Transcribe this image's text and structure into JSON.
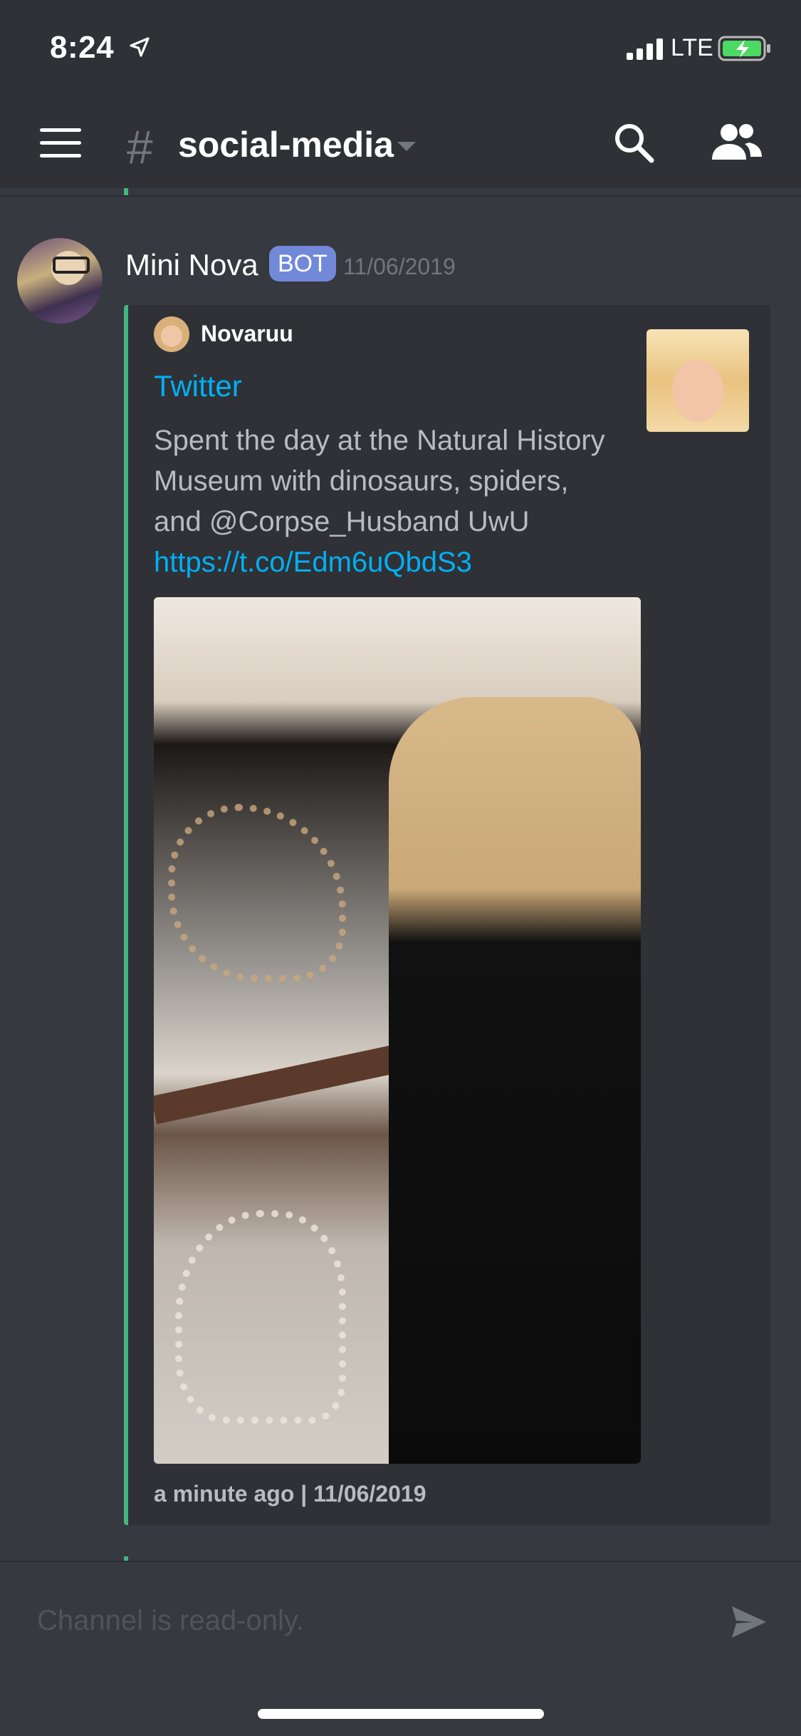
{
  "status_bar": {
    "time": "8:24",
    "network": "LTE"
  },
  "header": {
    "hash": "#",
    "channel": "social-media",
    "icons": [
      "menu-icon",
      "chevron-down-icon",
      "search-icon",
      "members-icon"
    ]
  },
  "message": {
    "author": "Mini Nova",
    "badge": "BOT",
    "date": "11/06/2019",
    "embed": {
      "author": "Novaruu",
      "title": "Twitter",
      "description": "Spent the day at the Natural History Museum with dinosaurs, spiders, and @Corpse_Husband UwU ",
      "link": "https://t.co/Edm6uQbdS3",
      "footer": "a minute ago | 11/06/2019",
      "accent_color": "#43b581"
    }
  },
  "input": {
    "placeholder": "Channel is read-only."
  },
  "colors": {
    "background": "#36393f",
    "header": "#2f3136",
    "link": "#00b0f4",
    "bot_badge": "#7289da"
  }
}
